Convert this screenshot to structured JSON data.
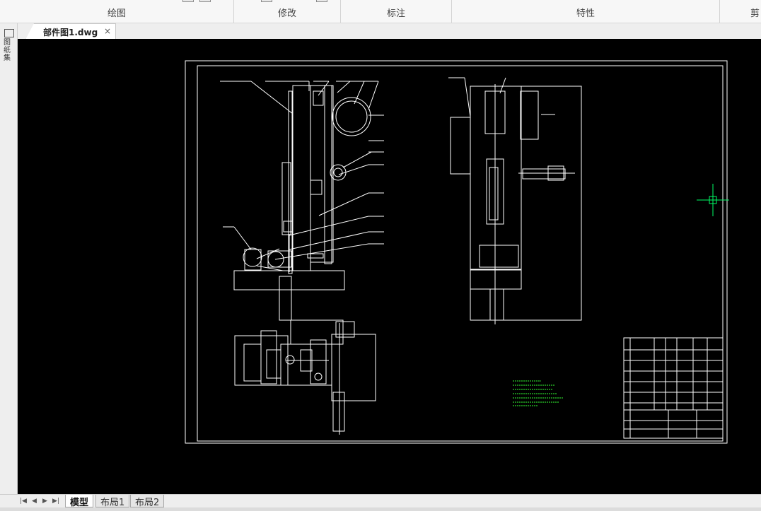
{
  "ribbon": {
    "groups": [
      {
        "label": "绘图"
      },
      {
        "label": "修改"
      },
      {
        "label": "标注"
      },
      {
        "label": "特性"
      },
      {
        "label": "剪"
      }
    ]
  },
  "document_tab": {
    "name": "部件图1.dwg",
    "close_glyph": "×"
  },
  "left_panel": {
    "label": "图纸集"
  },
  "layout_tabs": {
    "nav": [
      "|◀",
      "◀",
      "▶",
      "▶|"
    ],
    "tabs": [
      "模型",
      "布局1",
      "布局2"
    ],
    "active": "模型"
  },
  "colors": {
    "canvas": "#000000",
    "lines": "#ffffff",
    "crosshair": "#00ff66",
    "annotation": "#33ff33"
  }
}
